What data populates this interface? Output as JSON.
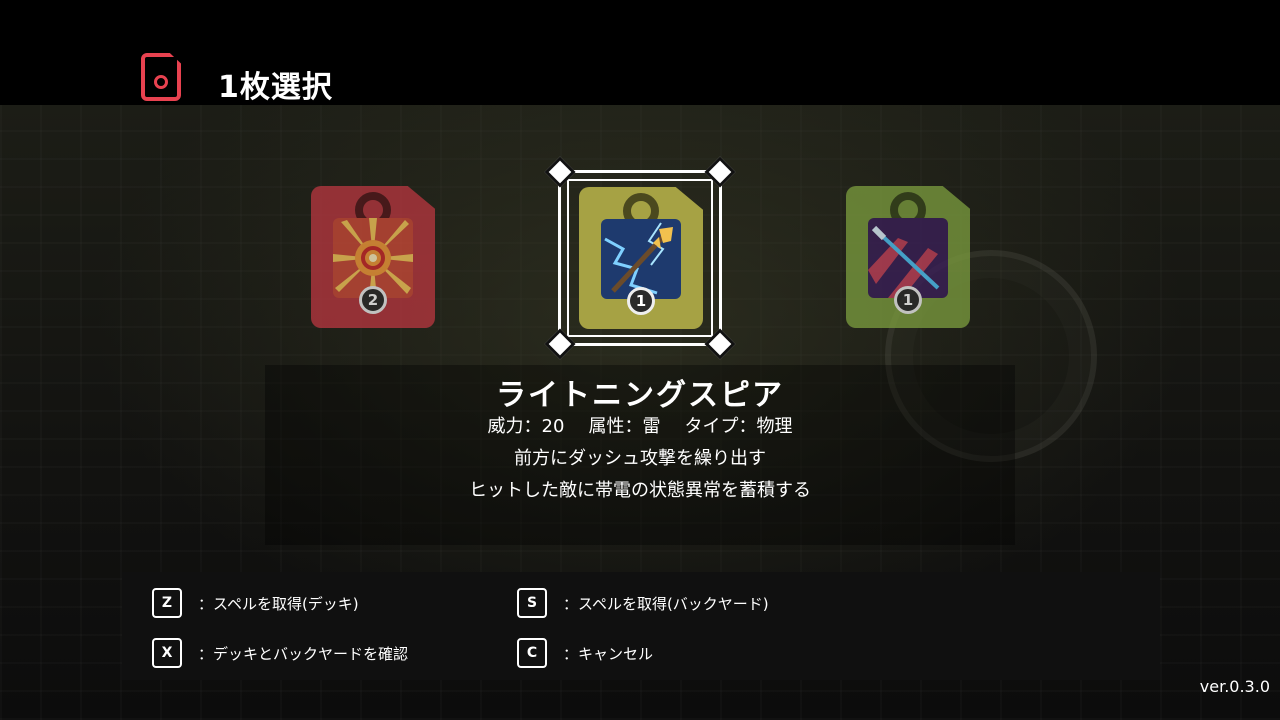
{
  "header": {
    "icon": "spell-card-icon",
    "title": "1枚選択"
  },
  "cards": [
    {
      "name": "sun-burst-spell",
      "color": "#b5363f",
      "count": "2",
      "selected": false
    },
    {
      "name": "lightning-spear-spell",
      "color": "#a6a244",
      "count": "1",
      "selected": true
    },
    {
      "name": "blade-slash-spell",
      "color": "#7a9a3e",
      "count": "1",
      "selected": false
    }
  ],
  "selected_spell": {
    "name": "ライトニングスピア",
    "power": "威力：20",
    "attribute": "属性：雷",
    "type": "タイプ：物理",
    "description_1": "前方にダッシュ攻撃を繰り出す",
    "description_2": "ヒットした敵に帯電の状態異常を蓄積する"
  },
  "controls": [
    {
      "key": "Z",
      "label": "：スペルを取得(デッキ)"
    },
    {
      "key": "S",
      "label": "：スペルを取得(バックヤード)"
    },
    {
      "key": "X",
      "label": "：デッキとバックヤードを確認"
    },
    {
      "key": "C",
      "label": "：キャンセル"
    }
  ],
  "version": "ver.0.3.0",
  "colors": {
    "accent": "#e84250",
    "selector": "#ffffff"
  }
}
